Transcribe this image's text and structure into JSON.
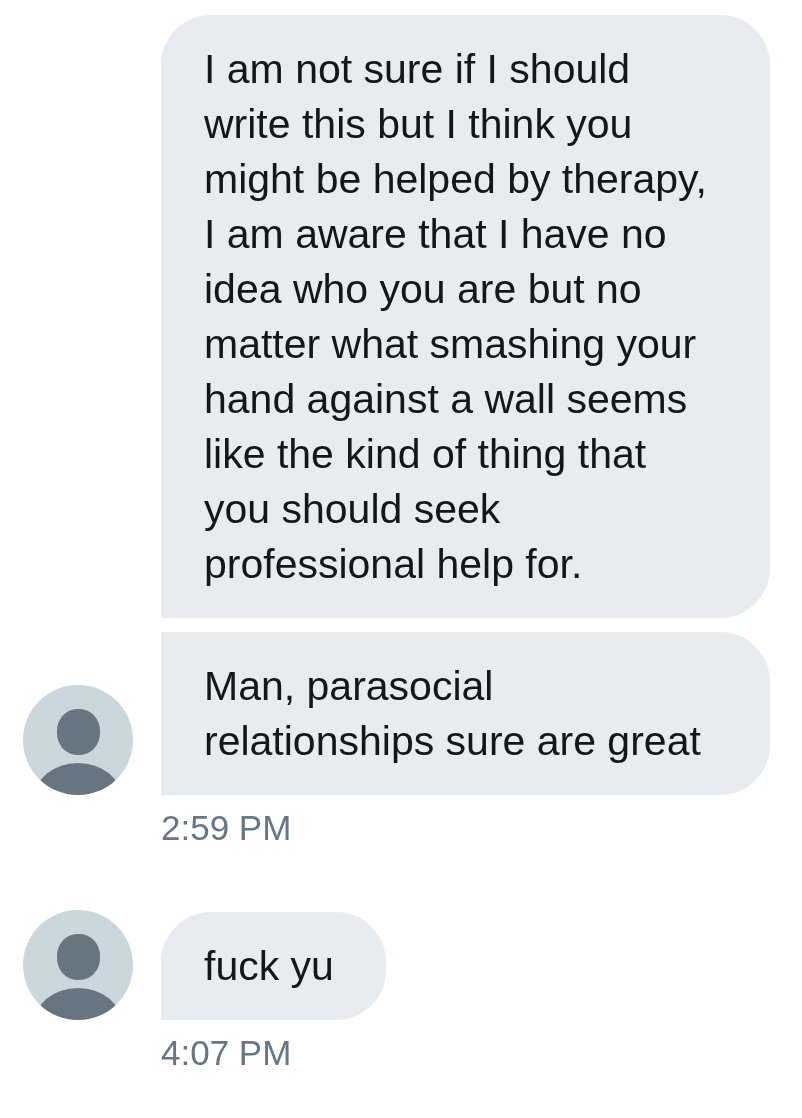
{
  "conversation": [
    {
      "messages": [
        "I am not sure if I should write this but I think you might be helped by therapy, I am aware that I have no idea who you are but no matter what smashing your hand against a wall seems like the kind of thing that you should seek professional help for.",
        "Man, parasocial relationships sure are great"
      ],
      "time": "2:59 PM"
    },
    {
      "messages": [
        "fuck yu"
      ],
      "time": "4:07 PM"
    }
  ]
}
